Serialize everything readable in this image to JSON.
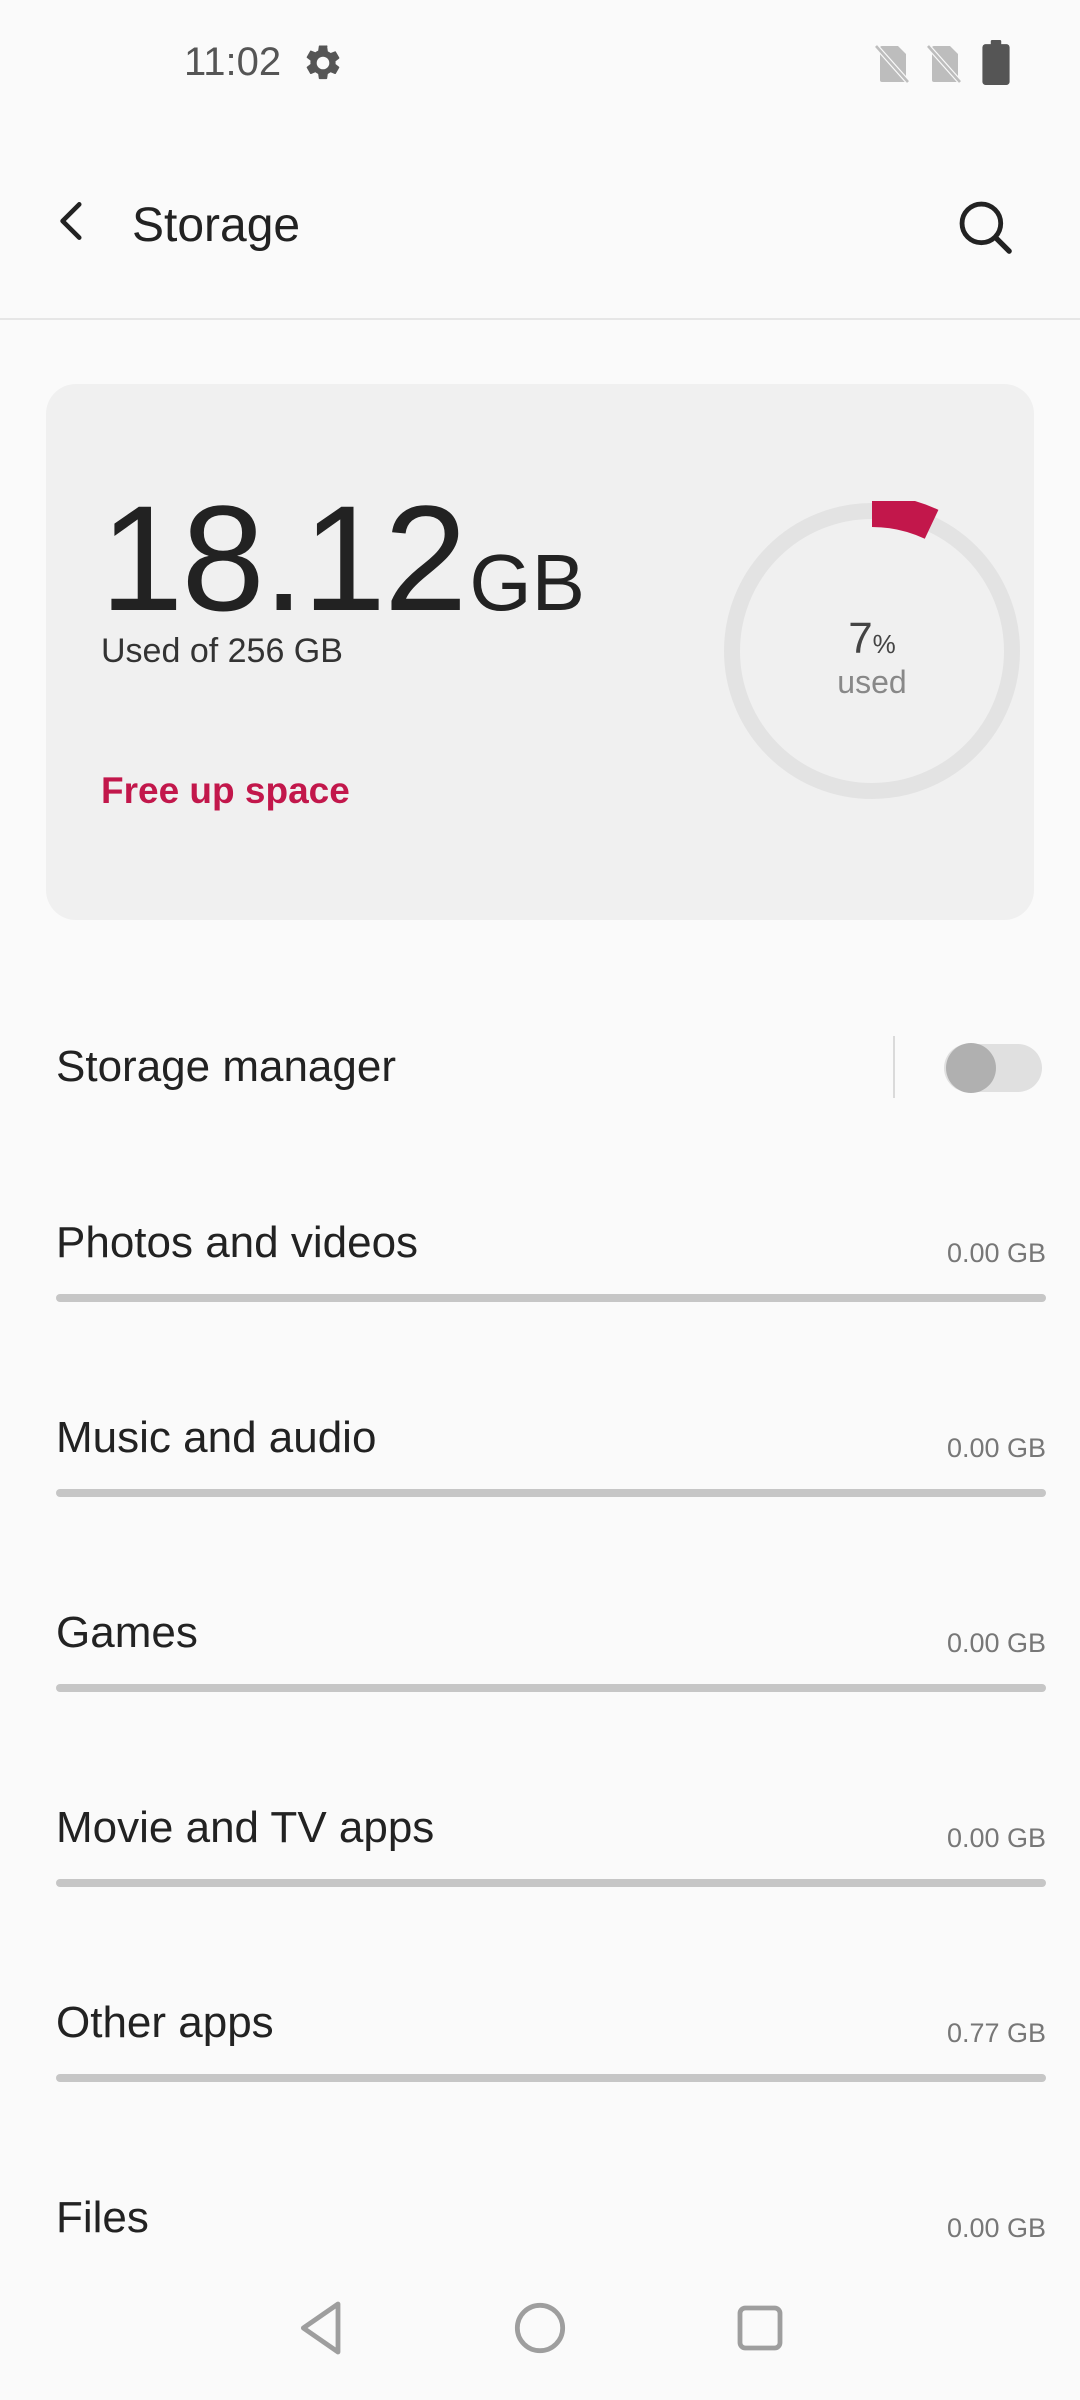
{
  "status_bar": {
    "time": "11:02",
    "icons": [
      "settings-gear-icon",
      "no-sim-icon",
      "no-sim-icon",
      "battery-icon"
    ]
  },
  "app_bar": {
    "title": "Storage",
    "back_icon": "arrow-back-icon",
    "search_icon": "search-icon"
  },
  "summary": {
    "used_number": "18.12",
    "used_unit": "GB",
    "used_of": "Used of 256 GB",
    "free_up_label": "Free up space",
    "percent_value": "7",
    "percent_sign": "%",
    "percent_caption": "used",
    "percent_fraction": 0.07,
    "accent_color": "#c2174b",
    "ring_track_color": "#e3e3e3"
  },
  "storage_manager": {
    "label": "Storage manager",
    "enabled": false
  },
  "categories": [
    {
      "label": "Photos and videos",
      "size": "0.00 GB",
      "fraction": 0
    },
    {
      "label": "Music and audio",
      "size": "0.00 GB",
      "fraction": 0
    },
    {
      "label": "Games",
      "size": "0.00 GB",
      "fraction": 0
    },
    {
      "label": "Movie and TV apps",
      "size": "0.00 GB",
      "fraction": 0
    },
    {
      "label": "Other apps",
      "size": "0.77 GB",
      "fraction": 0
    },
    {
      "label": "Files",
      "size": "0.00 GB",
      "fraction": 0
    }
  ],
  "nav_bar": {
    "icons": [
      "back-triangle-icon",
      "home-circle-icon",
      "recents-square-icon"
    ]
  }
}
